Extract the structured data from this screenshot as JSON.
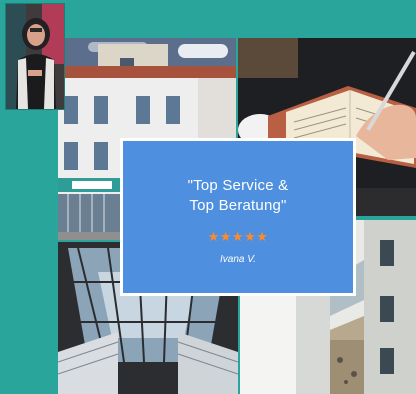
{
  "testimonial": {
    "quote_line1": "\"Top Service &",
    "quote_line2": "Top Beratung\"",
    "stars": "★★★★★",
    "author": "Ivana V."
  },
  "colors": {
    "background": "#2aa59c",
    "card": "#4e8fdf",
    "star": "#ff8a2a",
    "text": "#ffffff"
  },
  "images": [
    {
      "name": "portrait-photo"
    },
    {
      "name": "building-photo"
    },
    {
      "name": "writing-photo"
    },
    {
      "name": "atrium-photo"
    },
    {
      "name": "courtyard-photo"
    }
  ]
}
